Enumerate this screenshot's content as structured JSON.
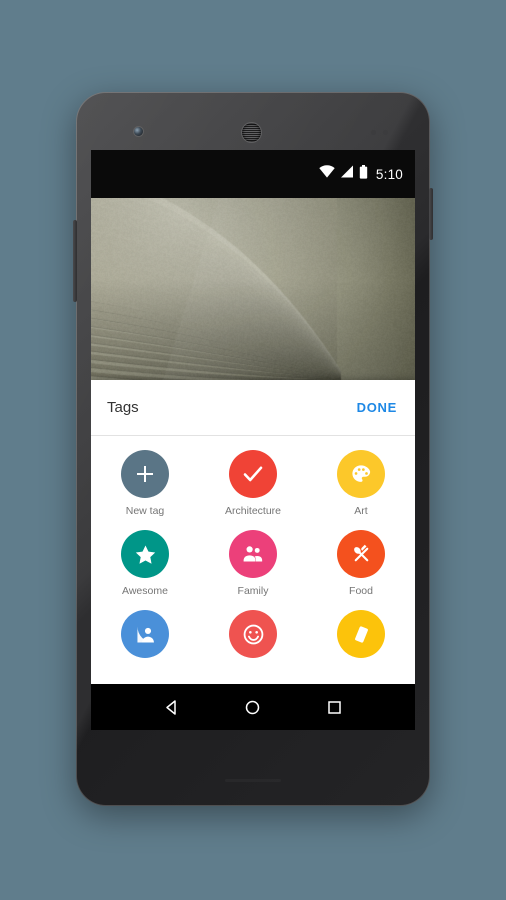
{
  "device": {
    "name": "android-phone",
    "body_color": "#2a2a2c",
    "background_color": "#607d8c",
    "sensors": [
      "front-camera",
      "earpiece-speaker",
      "proximity-sensor",
      "light-sensor"
    ],
    "side_buttons": [
      "power-button",
      "volume-button"
    ]
  },
  "status_bar": {
    "time": "5:10",
    "icons": [
      "wifi-icon",
      "cellular-signal-icon",
      "battery-icon"
    ],
    "background_color": "#0a0a0a",
    "foreground_color": "#ffffff"
  },
  "photo": {
    "name": "architecture-photo",
    "description": "Architectural curved ribbed ceiling",
    "tone_colors": [
      "#c9c8b6",
      "#8d8c76",
      "#5e5e4e",
      "#74736090"
    ]
  },
  "sheet": {
    "title": "Tags",
    "done_label": "DONE",
    "done_color": "#1e88e5",
    "background_color": "#ffffff",
    "title_color": "#333333"
  },
  "tags": [
    {
      "label": "New tag",
      "color": "#5a7586",
      "icon": "plus-icon",
      "name": "tag-new-tag"
    },
    {
      "label": "Architecture",
      "color": "#f04336",
      "icon": "check-icon",
      "name": "tag-architecture"
    },
    {
      "label": "Art",
      "color": "#fcc82a",
      "icon": "palette-icon",
      "name": "tag-art"
    },
    {
      "label": "Awesome",
      "color": "#009688",
      "icon": "star-icon",
      "name": "tag-awesome"
    },
    {
      "label": "Family",
      "color": "#ec407a",
      "icon": "people-icon",
      "name": "tag-family"
    },
    {
      "label": "Food",
      "color": "#f4511e",
      "icon": "cutlery-icon",
      "name": "tag-food"
    },
    {
      "label": "",
      "color": "#4a90d9",
      "icon": "portrait-icon",
      "name": "tag-portrait"
    },
    {
      "label": "",
      "color": "#ef5350",
      "icon": "smiley-icon",
      "name": "tag-smiley"
    },
    {
      "label": "",
      "color": "#fcc30b",
      "icon": "book-icon",
      "name": "tag-book"
    }
  ],
  "nav_bar": {
    "background_color": "#000000",
    "buttons": [
      {
        "name": "nav-back-button",
        "icon": "back-triangle-icon"
      },
      {
        "name": "nav-home-button",
        "icon": "home-circle-icon"
      },
      {
        "name": "nav-recents-button",
        "icon": "recents-square-icon"
      }
    ]
  }
}
